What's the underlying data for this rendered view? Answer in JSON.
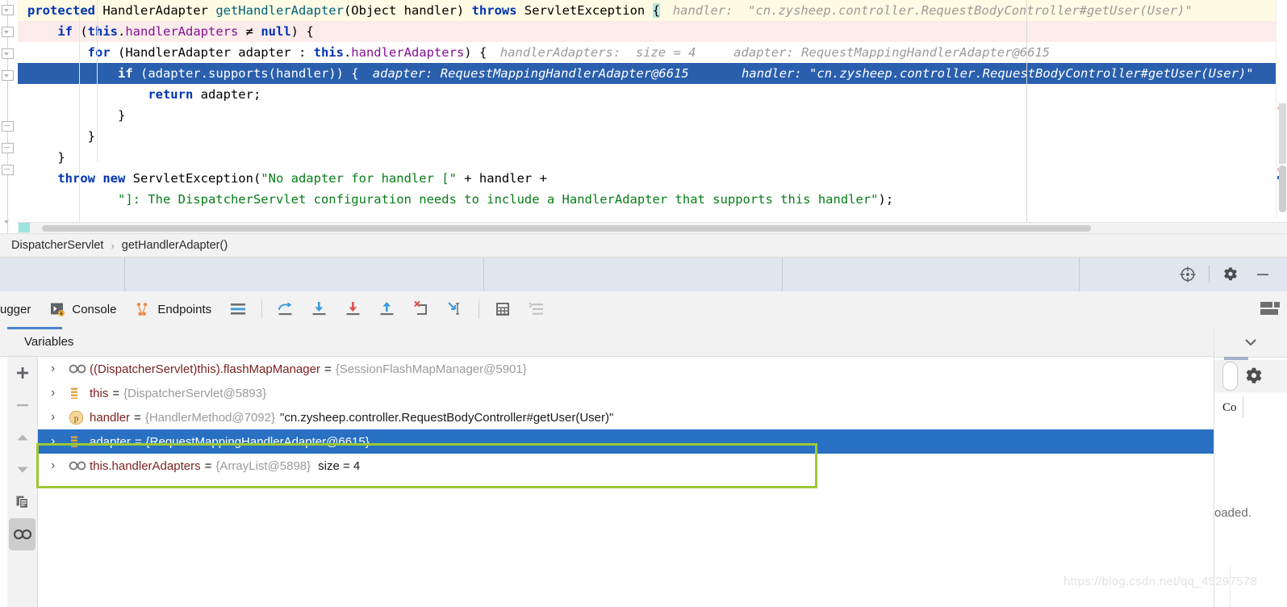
{
  "editor": {
    "lines": [
      {
        "id": "l1",
        "highlight": "yellow",
        "segments": [
          {
            "text": "protected ",
            "cls": "kw"
          },
          {
            "text": "HandlerAdapter ",
            "cls": "plain"
          },
          {
            "text": "getHandlerAdapter",
            "cls": "meth"
          },
          {
            "text": "(Object handler) ",
            "cls": "plain"
          },
          {
            "text": "throws ",
            "cls": "kw"
          },
          {
            "text": "ServletException ",
            "cls": "plain"
          },
          {
            "text": "{",
            "cls": "caret"
          }
        ],
        "hint": "handler:  \"cn.zysheep.controller.RequestBodyController#getUser(User)\"",
        "indent": 0
      },
      {
        "id": "l2",
        "highlight": "pink",
        "segments": [
          {
            "text": "    ",
            "cls": "plain"
          },
          {
            "text": "if ",
            "cls": "kw"
          },
          {
            "text": "(",
            "cls": "plain"
          },
          {
            "text": "this",
            "cls": "kw"
          },
          {
            "text": ".",
            "cls": "plain"
          },
          {
            "text": "handlerAdapters ",
            "cls": "fld"
          },
          {
            "text": "≠ ",
            "cls": "plain"
          },
          {
            "text": "null",
            "cls": "kw"
          },
          {
            "text": ") {",
            "cls": "plain"
          }
        ],
        "hint": "",
        "indent": 4
      },
      {
        "id": "l3",
        "highlight": "none",
        "segments": [
          {
            "text": "        ",
            "cls": "plain"
          },
          {
            "text": "for ",
            "cls": "kw"
          },
          {
            "text": "(HandlerAdapter adapter : ",
            "cls": "plain"
          },
          {
            "text": "this",
            "cls": "kw"
          },
          {
            "text": ".",
            "cls": "plain"
          },
          {
            "text": "handlerAdapters",
            "cls": "fld"
          },
          {
            "text": ") {",
            "cls": "plain"
          }
        ],
        "hint": "handlerAdapters:  size = 4     adapter: RequestMappingHandlerAdapter@6615",
        "indent": 8
      },
      {
        "id": "l4",
        "highlight": "selected",
        "segments": [
          {
            "text": "            ",
            "cls": "plain"
          },
          {
            "text": "if ",
            "cls": "kw"
          },
          {
            "text": "(adapter.",
            "cls": "plain"
          },
          {
            "text": "supports",
            "cls": "meth"
          },
          {
            "text": "(handler)) {",
            "cls": "plain"
          }
        ],
        "hint": "adapter: RequestMappingHandlerAdapter@6615       handler: \"cn.zysheep.controller.RequestBodyController#getUser(User)\"",
        "indent": 12
      },
      {
        "id": "l5",
        "highlight": "none",
        "segments": [
          {
            "text": "                ",
            "cls": "plain"
          },
          {
            "text": "return ",
            "cls": "kw"
          },
          {
            "text": "adapter;",
            "cls": "plain"
          }
        ],
        "hint": "",
        "indent": 16
      },
      {
        "id": "l6",
        "highlight": "none",
        "segments": [
          {
            "text": "            }",
            "cls": "plain"
          }
        ],
        "hint": "",
        "indent": 12
      },
      {
        "id": "l7",
        "highlight": "none",
        "segments": [
          {
            "text": "        }",
            "cls": "plain"
          }
        ],
        "hint": "",
        "indent": 8
      },
      {
        "id": "l8",
        "highlight": "none",
        "segments": [
          {
            "text": "    }",
            "cls": "plain"
          }
        ],
        "hint": "",
        "indent": 4
      },
      {
        "id": "l9",
        "highlight": "none",
        "segments": [
          {
            "text": "    ",
            "cls": "plain"
          },
          {
            "text": "throw new ",
            "cls": "kw"
          },
          {
            "text": "ServletException(",
            "cls": "plain"
          },
          {
            "text": "\"No adapter for handler [\"",
            "cls": "str"
          },
          {
            "text": " + handler +",
            "cls": "plain"
          }
        ],
        "hint": "",
        "indent": 4
      },
      {
        "id": "l10",
        "highlight": "none",
        "segments": [
          {
            "text": "            ",
            "cls": "plain"
          },
          {
            "text": "\"]: The DispatcherServlet configuration needs to include a HandlerAdapter that supports this handler\"",
            "cls": "str"
          },
          {
            "text": ");",
            "cls": "plain"
          }
        ],
        "hint": "",
        "indent": 12
      }
    ],
    "margin_guide_x": 1272
  },
  "breadcrumb": {
    "items": [
      "DispatcherServlet",
      "getHandlerAdapter()"
    ],
    "separator": "›"
  },
  "segbar": {
    "icons": [
      "crosshair-icon",
      "gear-icon",
      "minimize-icon"
    ]
  },
  "debug_toolbar": {
    "tabs": [
      {
        "label": "ugger",
        "icon": "debugger-icon",
        "name": "tab-debugger"
      },
      {
        "label": "Console",
        "icon": "console-icon",
        "name": "tab-console"
      },
      {
        "label": "Endpoints",
        "icon": "endpoints-icon",
        "name": "tab-endpoints"
      }
    ],
    "buttons": [
      {
        "name": "show-execution-point-button",
        "icon": "lines-icon"
      },
      {
        "name": "step-over-button",
        "icon": "step-over-icon"
      },
      {
        "name": "step-into-button",
        "icon": "step-into-icon"
      },
      {
        "name": "force-step-into-button",
        "icon": "force-step-into-icon"
      },
      {
        "name": "step-out-button",
        "icon": "step-out-icon"
      },
      {
        "name": "drop-frame-button",
        "icon": "drop-frame-icon"
      },
      {
        "name": "run-to-cursor-button",
        "icon": "run-to-cursor-icon"
      },
      {
        "name": "evaluate-expression-button",
        "icon": "calculator-icon"
      },
      {
        "name": "settings-button",
        "icon": "sort-lines-icon"
      }
    ],
    "layout_button": "layout-settings-icon"
  },
  "variables": {
    "title": "Variables",
    "left_tools": [
      {
        "name": "add-watch-button",
        "icon": "plus-icon"
      },
      {
        "name": "remove-watch-button",
        "icon": "minus-icon"
      },
      {
        "name": "move-up-button",
        "icon": "arrow-up-icon"
      },
      {
        "name": "move-down-button",
        "icon": "arrow-down-icon"
      },
      {
        "name": "copy-value-button",
        "icon": "copy-icon"
      },
      {
        "name": "watches-toggle-button",
        "icon": "glasses-icon"
      }
    ],
    "rows": [
      {
        "icon": "glasses-icon",
        "name": "((DispatcherServlet)this).flashMapManager",
        "eq": "=",
        "ref": "{SessionFlashMapManager@5901}",
        "value": "",
        "size": "",
        "selected": false,
        "boxed": false
      },
      {
        "icon": "field-icon",
        "name": "this",
        "eq": "=",
        "ref": "{DispatcherServlet@5893}",
        "value": "",
        "size": "",
        "selected": false,
        "boxed": false
      },
      {
        "icon": "parameter-icon",
        "name": "handler",
        "eq": "=",
        "ref": "{HandlerMethod@7092}",
        "value": "\"cn.zysheep.controller.RequestBodyController#getUser(User)\"",
        "size": "",
        "selected": false,
        "boxed": true
      },
      {
        "icon": "field-icon",
        "name": "adapter",
        "eq": "=",
        "ref": "{RequestMappingHandlerAdapter@6615}",
        "value": "",
        "size": "",
        "selected": true,
        "boxed": true
      },
      {
        "icon": "glasses-icon",
        "name": "this.handlerAdapters",
        "eq": "=",
        "ref": "{ArrayList@5898}",
        "value": "",
        "size": "size = 4",
        "selected": false,
        "boxed": false
      }
    ],
    "highlight_color": "#9cc934",
    "selection_color": "#2a70c2"
  },
  "right_pane": {
    "collapse_icon": "chevron-down-icon",
    "gear_icon": "gear-icon",
    "text": "Co",
    "loaded_text": "oaded."
  },
  "watermark": {
    "text": "https://blog.csdn.net/qq_45297578"
  },
  "colors": {
    "selection_blue": "#2a5fad",
    "accent_green": "#9cc934",
    "keyword_blue": "#0033b3",
    "string_green": "#067d17",
    "field_purple": "#871094",
    "method_teal": "#00627a"
  }
}
